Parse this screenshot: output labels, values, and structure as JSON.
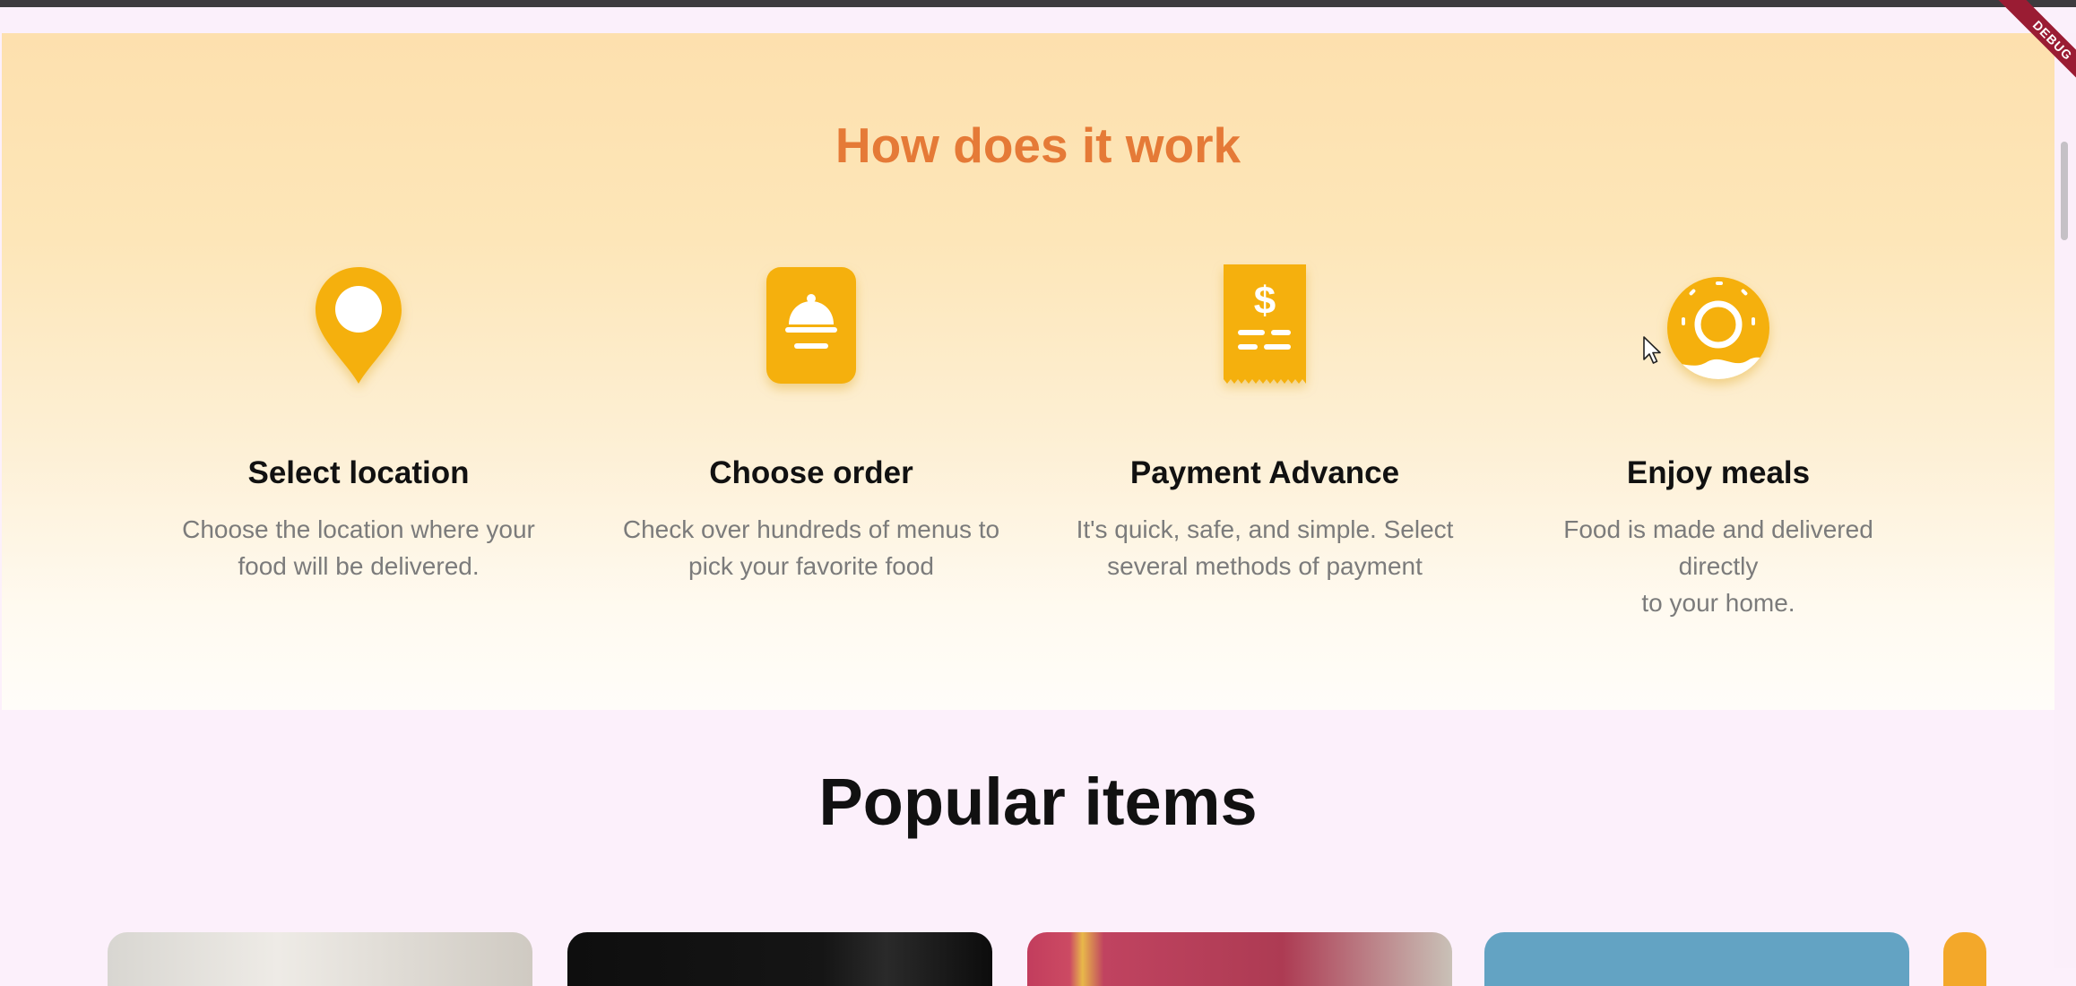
{
  "how_section": {
    "title": "How does it work",
    "steps": [
      {
        "icon": "location-pin-icon",
        "title": "Select location",
        "desc_line1": "Choose the location where your",
        "desc_line2": "food will be delivered."
      },
      {
        "icon": "cloche-order-icon",
        "title": "Choose order",
        "desc_line1": "Check over hundreds of menus to",
        "desc_line2": "pick your favorite food"
      },
      {
        "icon": "receipt-dollar-icon",
        "title": "Payment Advance",
        "desc_line1": "It's quick, safe, and simple. Select",
        "desc_line2": "several methods of payment"
      },
      {
        "icon": "donut-icon",
        "title": "Enjoy meals",
        "desc_line1": "Food is made and delivered directly",
        "desc_line2": "to your home."
      }
    ]
  },
  "popular": {
    "title": "Popular items"
  },
  "debug_banner": {
    "label": "DEBUG"
  },
  "colors": {
    "accent": "#e57a37",
    "icon": "#f5b00f",
    "background": "#fcf0fb"
  }
}
